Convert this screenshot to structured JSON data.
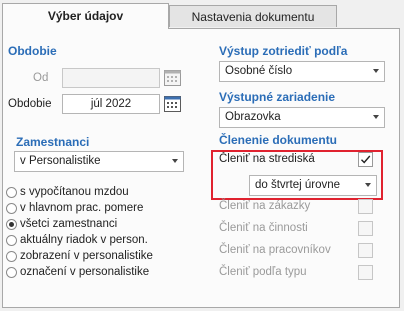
{
  "tabs": [
    {
      "label": "Výber údajov",
      "active": true
    },
    {
      "label": "Nastavenia dokumentu",
      "active": false
    }
  ],
  "obdobie": {
    "title": "Obdobie",
    "od_label": "Od",
    "od_value": "",
    "obdobie_label": "Obdobie",
    "obdobie_value": "júl 2022"
  },
  "zamestnanci": {
    "title": "Zamestnanci",
    "select_value": "v Personalistike",
    "options": [
      {
        "label": "s vypočítanou mzdou",
        "selected": false
      },
      {
        "label": "v hlavnom prac. pomere",
        "selected": false
      },
      {
        "label": "všetci zamestnanci",
        "selected": true
      },
      {
        "label": "aktuálny riadok v person.",
        "selected": false
      },
      {
        "label": "zobrazení v personalistike",
        "selected": false
      },
      {
        "label": "označení v personalistike",
        "selected": false
      }
    ]
  },
  "vystup_zotriedit": {
    "title": "Výstup zotriediť podľa",
    "select_value": "Osobné číslo"
  },
  "vystupne_zariadenie": {
    "title": "Výstupné zariadenie",
    "select_value": "Obrazovka"
  },
  "clenenie": {
    "title": "Členenie dokumentu",
    "strediska_label": "Členiť na strediská",
    "strediska_checked": true,
    "uroven_value": "do štvrtej úrovne",
    "items": [
      {
        "label": "Členiť na zákazky",
        "checked": false
      },
      {
        "label": "Členiť na činnosti",
        "checked": false
      },
      {
        "label": "Členiť na pracovníkov",
        "checked": false
      },
      {
        "label": "Členiť podľa typu",
        "checked": false
      }
    ]
  },
  "colors": {
    "section_title": "#2b6db7",
    "highlight": "#e0222f"
  },
  "icons": {
    "calendar": "calendar-icon",
    "dropdown": "chevron-down-icon",
    "check": "check-icon"
  }
}
